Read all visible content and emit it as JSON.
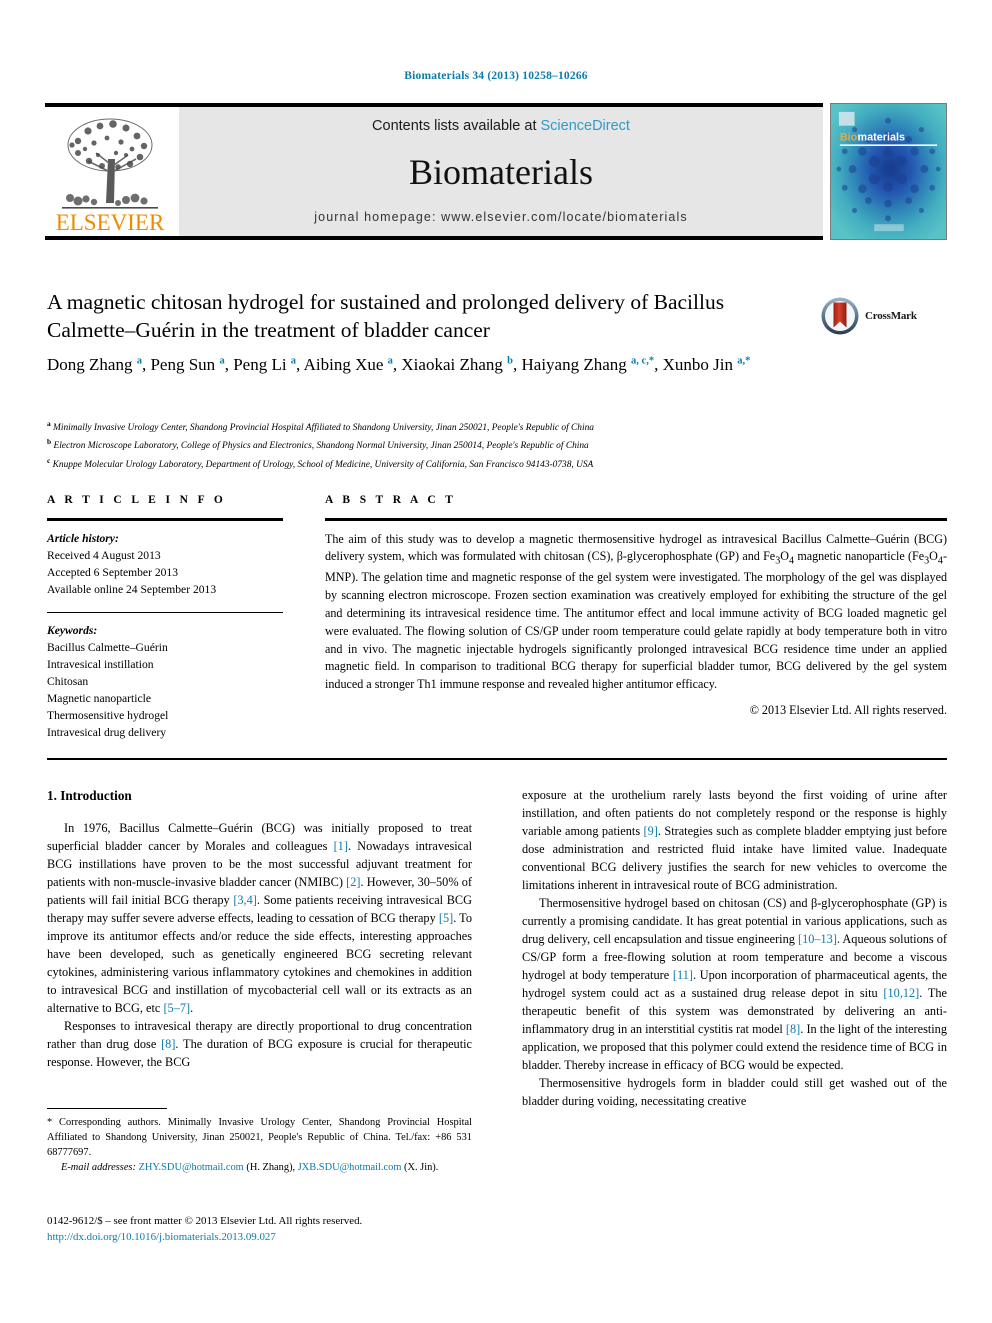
{
  "running_head": "Biomaterials 34 (2013) 10258–10266",
  "masthead": {
    "contents_prefix": "Contents lists available at ",
    "contents_link": "ScienceDirect",
    "journal_title": "Biomaterials",
    "homepage": "journal homepage: www.elsevier.com/locate/biomaterials",
    "publisher_logo_text": "ELSEVIER",
    "cover_title_a": "Bio",
    "cover_title_b": "materials",
    "colors": {
      "link": "#2e9bc9",
      "accent": "#0b7bab",
      "elsevier_orange": "#ED8B00",
      "band": "#e6e6e6"
    }
  },
  "crossmark": {
    "label": "CrossMark"
  },
  "article": {
    "title": "A magnetic chitosan hydrogel for sustained and prolonged delivery of Bacillus Calmette–Guérin in the treatment of bladder cancer",
    "authors_html": "Dong Zhang <sup>a</sup>, Peng Sun <sup>a</sup>, Peng Li <sup>a</sup>, Aibing Xue <sup>a</sup>, Xiaokai Zhang <sup>b</sup>, Haiyang Zhang <sup>a, c,</sup><sup>*</sup>, Xunbo Jin <sup>a,</sup><sup>*</sup>",
    "affiliations": [
      {
        "marker": "a",
        "text": "Minimally Invasive Urology Center, Shandong Provincial Hospital Affiliated to Shandong University, Jinan 250021, People's Republic of China"
      },
      {
        "marker": "b",
        "text": "Electron Microscope Laboratory, College of Physics and Electronics, Shandong Normal University, Jinan 250014, People's Republic of China"
      },
      {
        "marker": "c",
        "text": "Knuppe Molecular Urology Laboratory, Department of Urology, School of Medicine, University of California, San Francisco 94143-0738, USA"
      }
    ]
  },
  "article_info": {
    "heading": "A R T I C L E   I N F O",
    "history_label": "Article history:",
    "history": [
      "Received 4 August 2013",
      "Accepted 6 September 2013",
      "Available online 24 September 2013"
    ],
    "keywords_label": "Keywords:",
    "keywords": [
      "Bacillus Calmette–Guérin",
      "Intravesical instillation",
      "Chitosan",
      "Magnetic nanoparticle",
      "Thermosensitive hydrogel",
      "Intravesical drug delivery"
    ]
  },
  "abstract": {
    "heading": "A B S T R A C T",
    "text_html": "The aim of this study was to develop a magnetic thermosensitive hydrogel as intravesical Bacillus Calmette–Guérin (BCG) delivery system, which was formulated with chitosan (CS), β-glycerophosphate (GP) and Fe<sub>3</sub>O<sub>4</sub> magnetic nanoparticle (Fe<sub>3</sub>O<sub>4</sub>-MNP). The gelation time and magnetic response of the gel system were investigated. The morphology of the gel was displayed by scanning electron microscope. Frozen section examination was creatively employed for exhibiting the structure of the gel and determining its intravesical residence time. The antitumor effect and local immune activity of BCG loaded magnetic gel were evaluated. The flowing solution of CS/GP under room temperature could gelate rapidly at body temperature both in vitro and in vivo. The magnetic injectable hydrogels significantly prolonged intravesical BCG residence time under an applied magnetic field. In comparison to traditional BCG therapy for superficial bladder tumor, BCG delivered by the gel system induced a stronger Th1 immune response and revealed higher antitumor efficacy.",
    "copyright": "© 2013 Elsevier Ltd. All rights reserved."
  },
  "body": {
    "section_heading": "1.  Introduction",
    "left_paragraphs_html": [
      "In 1976, Bacillus Calmette–Guérin (BCG) was initially proposed to treat superficial bladder cancer by Morales and colleagues <span class=\"ref\">[1]</span>. Nowadays intravesical BCG instillations have proven to be the most successful adjuvant treatment for patients with non-muscle-invasive bladder cancer (NMIBC) <span class=\"ref\">[2]</span>. However, 30–50% of patients will fail initial BCG therapy <span class=\"ref\">[3,4]</span>. Some patients receiving intravesical BCG therapy may suffer severe adverse effects, leading to cessation of BCG therapy <span class=\"ref\">[5]</span>. To improve its antitumor effects and/or reduce the side effects, interesting approaches have been developed, such as genetically engineered BCG secreting relevant cytokines, administering various inflammatory cytokines and chemokines in addition to intravesical BCG and instillation of mycobacterial cell wall or its extracts as an alternative to BCG, etc <span class=\"ref\">[5–7]</span>.",
      "Responses to intravesical therapy are directly proportional to drug concentration rather than drug dose <span class=\"ref\">[8]</span>. The duration of BCG exposure is crucial for therapeutic response. However, the BCG"
    ],
    "right_paragraphs_html": [
      "exposure at the urothelium rarely lasts beyond the first voiding of urine after instillation, and often patients do not completely respond or the response is highly variable among patients <span class=\"ref\">[9]</span>. Strategies such as complete bladder emptying just before dose administration and restricted fluid intake have limited value. Inadequate conventional BCG delivery justifies the search for new vehicles to overcome the limitations inherent in intravesical route of BCG administration.",
      "Thermosensitive hydrogel based on chitosan (CS) and β-glycerophosphate (GP) is currently a promising candidate. It has great potential in various applications, such as drug delivery, cell encapsulation and tissue engineering <span class=\"ref\">[10–13]</span>. Aqueous solutions of CS/GP form a free-flowing solution at room temperature and become a viscous hydrogel at body temperature <span class=\"ref\">[11]</span>. Upon incorporation of pharmaceutical agents, the hydrogel system could act as a sustained drug release depot in situ <span class=\"ref\">[10,12]</span>. The therapeutic benefit of this system was demonstrated by delivering an anti-inflammatory drug in an interstitial cystitis rat model <span class=\"ref\">[8]</span>. In the light of the interesting application, we proposed that this polymer could extend the residence time of BCG in bladder. Thereby increase in efficacy of BCG would be expected.",
      "Thermosensitive hydrogels form in bladder could still get washed out of the bladder during voiding, necessitating creative"
    ]
  },
  "footnotes": {
    "corresponding_html": "* Corresponding authors. Minimally Invasive Urology Center, Shandong Provincial Hospital Affiliated to Shandong University, Jinan 250021, People's Republic of China. Tel./fax: +86 531 68777697.",
    "email_label": "E-mail addresses:",
    "email_1": "ZHY.SDU@hotmail.com",
    "email_1_owner": "(H. Zhang)",
    "email_2": "JXB.SDU@hotmail.com",
    "email_2_owner": "(X. Jin)."
  },
  "imprint": {
    "line1": "0142-9612/$ – see front matter © 2013 Elsevier Ltd. All rights reserved.",
    "doi": "http://dx.doi.org/10.1016/j.biomaterials.2013.09.027"
  }
}
